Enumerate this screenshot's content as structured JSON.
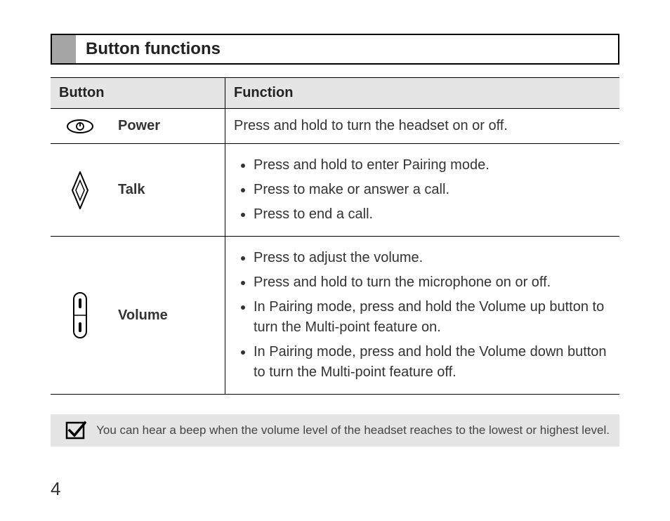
{
  "section_title": "Button functions",
  "table": {
    "headers": {
      "button": "Button",
      "function": "Function"
    },
    "rows": [
      {
        "icon": "power-icon",
        "name": "Power",
        "function_text": "Press and hold to turn the headset on or off."
      },
      {
        "icon": "talk-icon",
        "name": "Talk",
        "function_list": [
          "Press and hold to enter Pairing mode.",
          "Press to make or answer a call.",
          "Press to end a call."
        ]
      },
      {
        "icon": "volume-icon",
        "name": "Volume",
        "function_list": [
          "Press to adjust the volume.",
          "Press and hold to turn the microphone on or off.",
          "In Pairing mode, press and hold the Volume up button to turn the Multi-point feature on.",
          "In Pairing mode, press and hold the Volume down button to turn the Multi-point feature off."
        ]
      }
    ]
  },
  "note": "You can hear a beep when the volume level of the headset reaches to the lowest or highest level.",
  "page_number": "4"
}
